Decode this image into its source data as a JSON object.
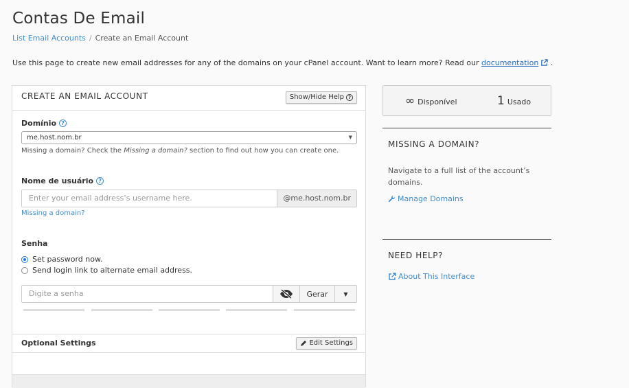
{
  "page": {
    "title": "Contas De Email",
    "breadcrumb": {
      "parent": "List Email Accounts",
      "separator": "/",
      "current": "Create an Email Account"
    },
    "intro_text": "Use this page to create new email addresses for any of the domains on your cPanel account. Want to learn more? Read our",
    "intro_link": "documentation",
    "intro_end": "."
  },
  "form": {
    "title": "CREATE AN EMAIL ACCOUNT",
    "show_hide_help": "Show/Hide Help",
    "domain_label": "Domínio",
    "domain_value": "me.host.nom.br",
    "domain_hint_pre": "Missing a domain? Check the",
    "domain_hint_em": "Missing a domain?",
    "domain_hint_post": "section to find out how you can create one.",
    "username_label": "Nome de usuário",
    "username_placeholder": "Enter your email address’s username here.",
    "username_suffix": "@me.host.nom.br",
    "missing_domain_link": "Missing a domain?",
    "password_label": "Senha",
    "radio_set_now": "Set password now.",
    "radio_send_link": "Send login link to alternate email address.",
    "password_placeholder": "Digite a senha",
    "generate_label": "Gerar",
    "optional_settings": "Optional Settings",
    "edit_settings": "Edit Settings"
  },
  "stats": {
    "available_num": "∞",
    "available_label": "Disponível",
    "used_num": "1",
    "used_label": "Usado"
  },
  "sidebar": {
    "missing_title": "MISSING A DOMAIN?",
    "missing_text": "Navigate to a full list of the account’s domains.",
    "manage_domains": "Manage Domains",
    "help_title": "NEED HELP?",
    "about_interface": "About This Interface"
  },
  "colors": {
    "link": "#428bca",
    "radio_accent": "#1a73e8"
  }
}
